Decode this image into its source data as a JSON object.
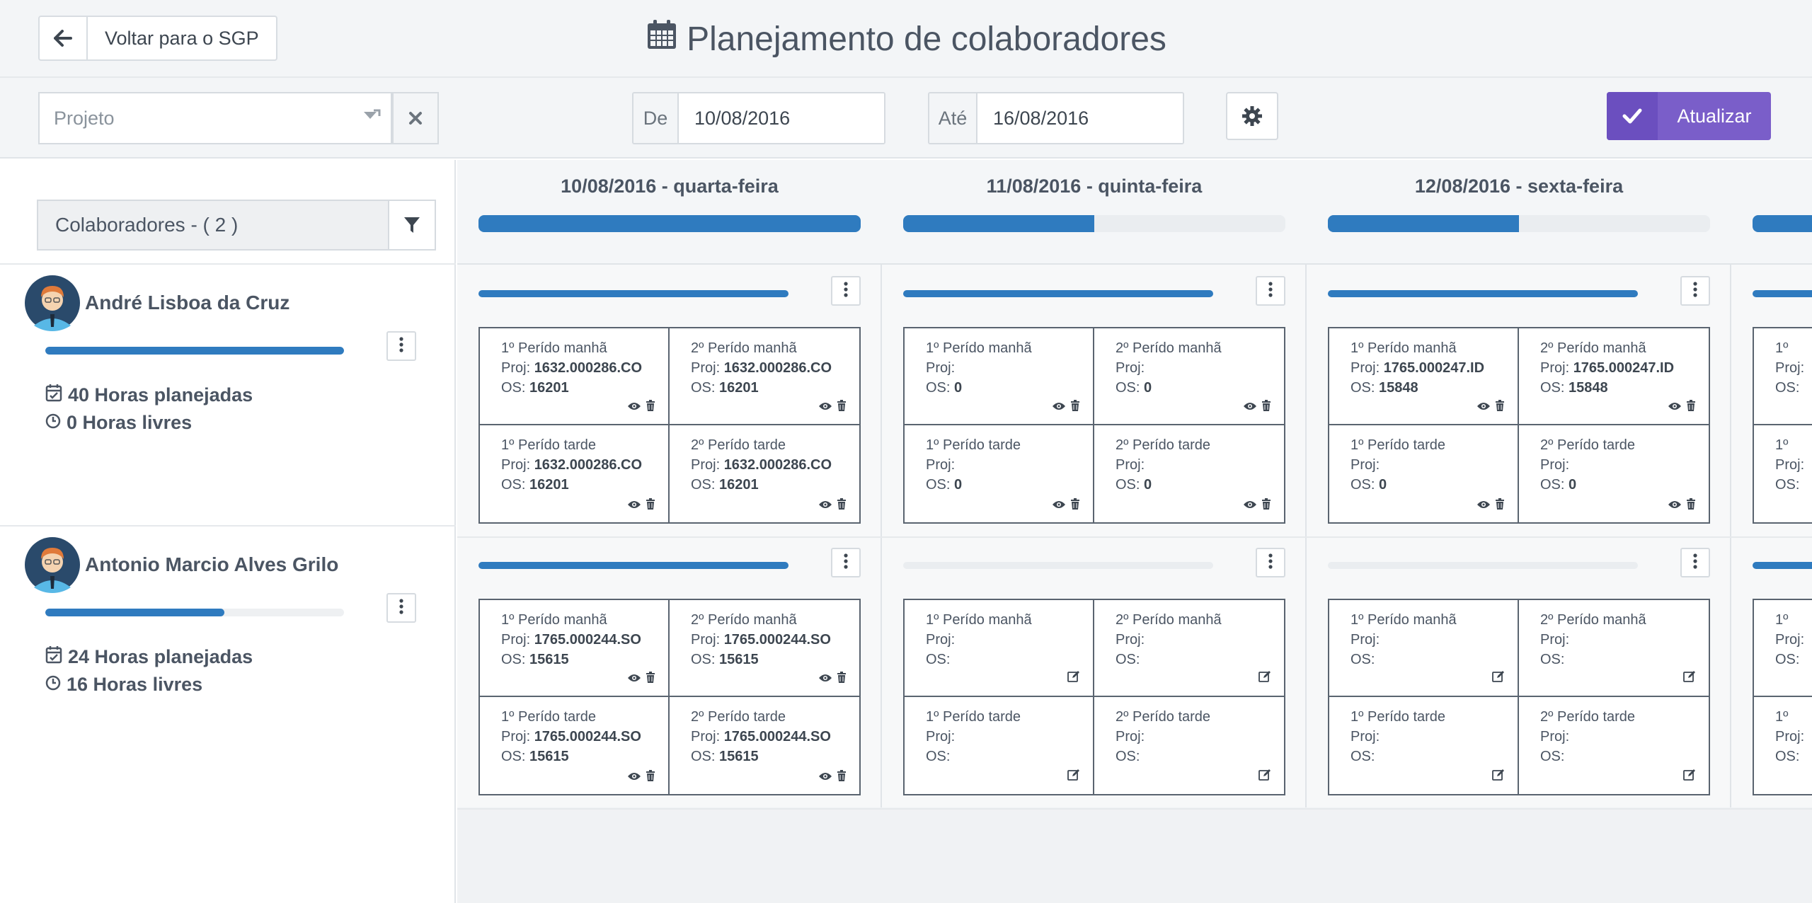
{
  "header": {
    "back_label": "Voltar para o SGP",
    "title": "Planejamento de colaboradores"
  },
  "filters": {
    "project_placeholder": "Projeto",
    "from_label": "De",
    "from_value": "10/08/2016",
    "to_label": "Até",
    "to_value": "16/08/2016",
    "update_label": "Atualizar"
  },
  "sidebar": {
    "collaborators_label": "Colaboradores - ( 2 )",
    "people": [
      {
        "name": "André Lisboa da Cruz",
        "progress": 1.0,
        "planned": "40 Horas planejadas",
        "free": "0 Horas livres"
      },
      {
        "name": "Antonio Marcio Alves Grilo",
        "progress": 0.6,
        "planned": "24 Horas planejadas",
        "free": "16 Horas livres"
      }
    ]
  },
  "days": [
    {
      "title": "10/08/2016 - quarta-feira",
      "progress": 1.0,
      "rows": [
        {
          "progress": 1.0,
          "cells": [
            {
              "period": "1º Perído manhã",
              "proj_label": "Proj:",
              "proj": "1632.000286.CO",
              "os_label": "OS:",
              "os": "16201",
              "mode": "view"
            },
            {
              "period": "2º Perído manhã",
              "proj_label": "Proj:",
              "proj": "1632.000286.CO",
              "os_label": "OS:",
              "os": "16201",
              "mode": "view"
            },
            {
              "period": "1º Perído tarde",
              "proj_label": "Proj:",
              "proj": "1632.000286.CO",
              "os_label": "OS:",
              "os": "16201",
              "mode": "view"
            },
            {
              "period": "2º Perído tarde",
              "proj_label": "Proj:",
              "proj": "1632.000286.CO",
              "os_label": "OS:",
              "os": "16201",
              "mode": "view"
            }
          ]
        },
        {
          "progress": 1.0,
          "cells": [
            {
              "period": "1º Perído manhã",
              "proj_label": "Proj:",
              "proj": "1765.000244.SO",
              "os_label": "OS:",
              "os": "15615",
              "mode": "view"
            },
            {
              "period": "2º Perído manhã",
              "proj_label": "Proj:",
              "proj": "1765.000244.SO",
              "os_label": "OS:",
              "os": "15615",
              "mode": "view"
            },
            {
              "period": "1º Perído tarde",
              "proj_label": "Proj:",
              "proj": "1765.000244.SO",
              "os_label": "OS:",
              "os": "15615",
              "mode": "view"
            },
            {
              "period": "2º Perído tarde",
              "proj_label": "Proj:",
              "proj": "1765.000244.SO",
              "os_label": "OS:",
              "os": "15615",
              "mode": "view"
            }
          ]
        }
      ]
    },
    {
      "title": "11/08/2016 - quinta-feira",
      "progress": 0.5,
      "rows": [
        {
          "progress": 1.0,
          "cells": [
            {
              "period": "1º Perído manhã",
              "proj_label": "Proj:",
              "proj": "",
              "os_label": "OS:",
              "os": "0",
              "mode": "view"
            },
            {
              "period": "2º Perído manhã",
              "proj_label": "Proj:",
              "proj": "",
              "os_label": "OS:",
              "os": "0",
              "mode": "view"
            },
            {
              "period": "1º Perído tarde",
              "proj_label": "Proj:",
              "proj": "",
              "os_label": "OS:",
              "os": "0",
              "mode": "view"
            },
            {
              "period": "2º Perído tarde",
              "proj_label": "Proj:",
              "proj": "",
              "os_label": "OS:",
              "os": "0",
              "mode": "view"
            }
          ]
        },
        {
          "progress": 0,
          "cells": [
            {
              "period": "1º Perído manhã",
              "proj_label": "Proj:",
              "proj": "",
              "os_label": "OS:",
              "os": "",
              "mode": "edit"
            },
            {
              "period": "2º Perído manhã",
              "proj_label": "Proj:",
              "proj": "",
              "os_label": "OS:",
              "os": "",
              "mode": "edit"
            },
            {
              "period": "1º Perído tarde",
              "proj_label": "Proj:",
              "proj": "",
              "os_label": "OS:",
              "os": "",
              "mode": "edit"
            },
            {
              "period": "2º Perído tarde",
              "proj_label": "Proj:",
              "proj": "",
              "os_label": "OS:",
              "os": "",
              "mode": "edit"
            }
          ]
        }
      ]
    },
    {
      "title": "12/08/2016 - sexta-feira",
      "progress": 0.5,
      "rows": [
        {
          "progress": 1.0,
          "cells": [
            {
              "period": "1º Perído manhã",
              "proj_label": "Proj:",
              "proj": "1765.000247.ID",
              "os_label": "OS:",
              "os": "15848",
              "mode": "view"
            },
            {
              "period": "2º Perído manhã",
              "proj_label": "Proj:",
              "proj": "1765.000247.ID",
              "os_label": "OS:",
              "os": "15848",
              "mode": "view"
            },
            {
              "period": "1º Perído tarde",
              "proj_label": "Proj:",
              "proj": "",
              "os_label": "OS:",
              "os": "0",
              "mode": "view"
            },
            {
              "period": "2º Perído tarde",
              "proj_label": "Proj:",
              "proj": "",
              "os_label": "OS:",
              "os": "0",
              "mode": "view"
            }
          ]
        },
        {
          "progress": 0,
          "cells": [
            {
              "period": "1º Perído manhã",
              "proj_label": "Proj:",
              "proj": "",
              "os_label": "OS:",
              "os": "",
              "mode": "edit"
            },
            {
              "period": "2º Perído manhã",
              "proj_label": "Proj:",
              "proj": "",
              "os_label": "OS:",
              "os": "",
              "mode": "edit"
            },
            {
              "period": "1º Perído tarde",
              "proj_label": "Proj:",
              "proj": "",
              "os_label": "OS:",
              "os": "",
              "mode": "edit"
            },
            {
              "period": "2º Perído tarde",
              "proj_label": "Proj:",
              "proj": "",
              "os_label": "OS:",
              "os": "",
              "mode": "edit"
            }
          ]
        }
      ]
    },
    {
      "title": "",
      "progress": 1.0,
      "rows": [
        {
          "progress": 1.0,
          "cells": [
            {
              "period": "1º",
              "proj_label": "Proj:",
              "proj": "",
              "os_label": "OS:",
              "os": "",
              "mode": "none"
            },
            {
              "period": "",
              "proj_label": "",
              "proj": "",
              "os_label": "",
              "os": "",
              "mode": "none"
            },
            {
              "period": "1º",
              "proj_label": "Proj:",
              "proj": "",
              "os_label": "OS:",
              "os": "",
              "mode": "none"
            },
            {
              "period": "",
              "proj_label": "",
              "proj": "",
              "os_label": "",
              "os": "",
              "mode": "none"
            }
          ]
        },
        {
          "progress": 1.0,
          "cells": [
            {
              "period": "1º",
              "proj_label": "Proj:",
              "proj": "",
              "os_label": "OS:",
              "os": "",
              "mode": "none"
            },
            {
              "period": "",
              "proj_label": "",
              "proj": "",
              "os_label": "",
              "os": "",
              "mode": "none"
            },
            {
              "period": "1º",
              "proj_label": "Proj:",
              "proj": "",
              "os_label": "OS:",
              "os": "",
              "mode": "none"
            },
            {
              "period": "",
              "proj_label": "",
              "proj": "",
              "os_label": "",
              "os": "",
              "mode": "none"
            }
          ]
        }
      ]
    }
  ]
}
